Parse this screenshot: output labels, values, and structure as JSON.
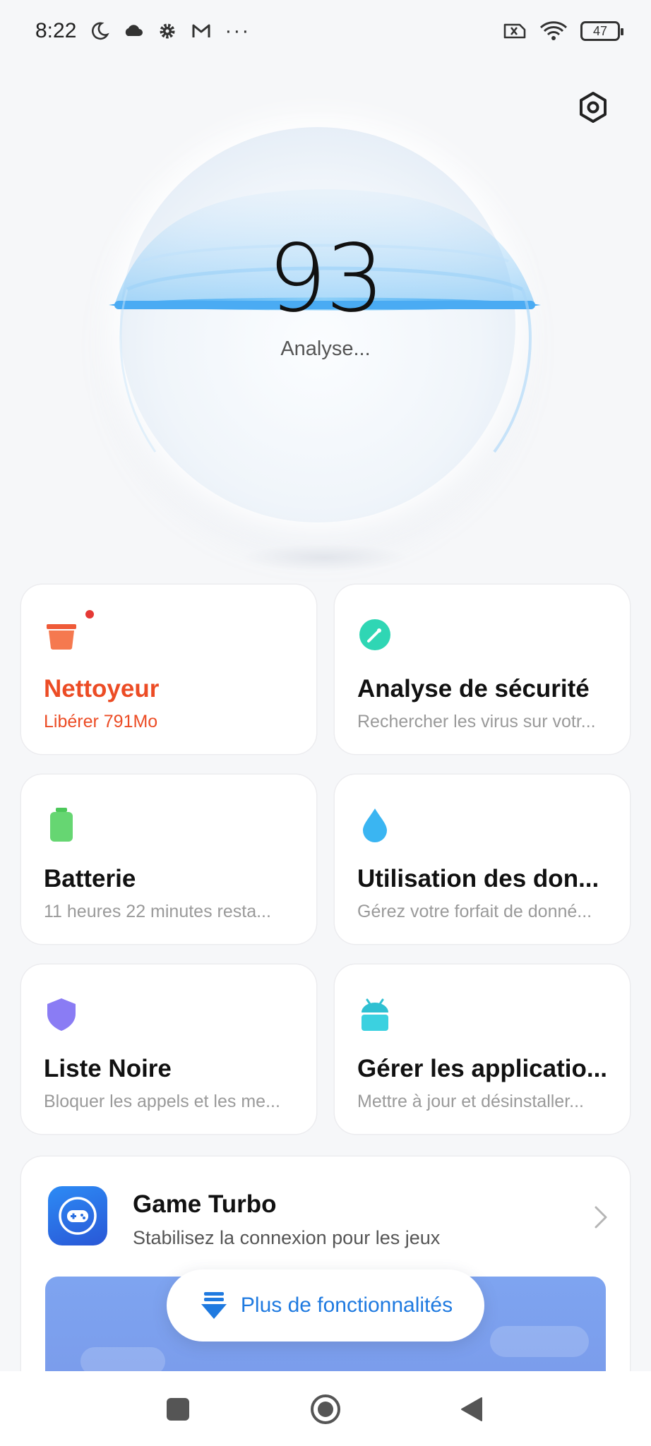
{
  "status_bar": {
    "time": "8:22",
    "battery_level": "47"
  },
  "scan": {
    "score": "93",
    "status": "Analyse..."
  },
  "tiles": [
    {
      "title": "Nettoyeur",
      "subtitle": "Libérer 791Mo",
      "icon": "trash-icon",
      "color": "#ef5a38"
    },
    {
      "title": "Analyse de sécurité",
      "subtitle": "Rechercher les virus sur votr...",
      "icon": "security-scan-icon",
      "color": "#2fd6b4"
    },
    {
      "title": "Batterie",
      "subtitle": "11 heures 22 minutes  resta...",
      "icon": "battery-icon",
      "color": "#5ed467"
    },
    {
      "title": "Utilisation des don...",
      "subtitle": "Gérez votre forfait de donné...",
      "icon": "water-drop-icon",
      "color": "#3ab5f2"
    },
    {
      "title": "Liste Noire",
      "subtitle": "Bloquer les appels et les me...",
      "icon": "shield-icon",
      "color": "#8a7cf4"
    },
    {
      "title": "Gérer les applicatio...",
      "subtitle": "Mettre à jour et désinstaller...",
      "icon": "android-icon",
      "color": "#3bd1e0"
    }
  ],
  "game_turbo": {
    "title": "Game Turbo",
    "subtitle": "Stabilisez la connexion pour les jeux"
  },
  "more_features": {
    "label": "Plus de fonctionnalités"
  },
  "colors": {
    "accent_blue": "#1f7ae0",
    "alert_orange": "#ec4c25",
    "ring_blue": "#4fb0f5"
  }
}
